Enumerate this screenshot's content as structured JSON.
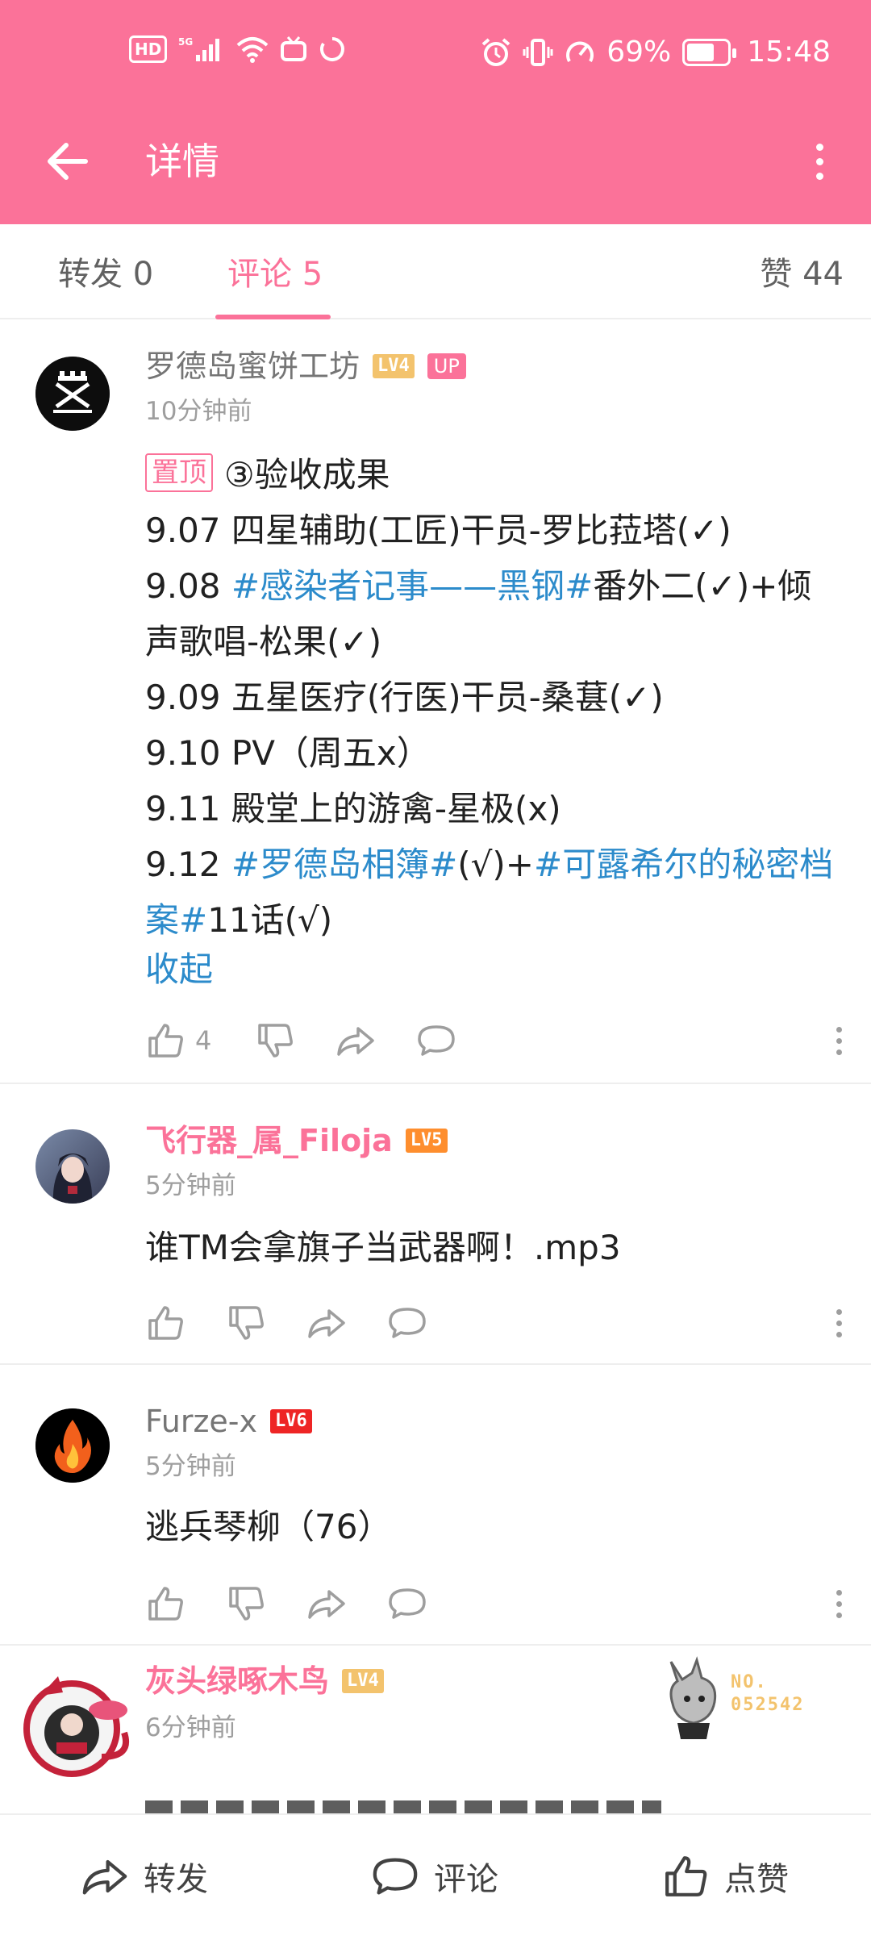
{
  "status_bar": {
    "hd": "HD",
    "network": "5G",
    "battery_percent_text": "69%",
    "battery_level": 0.69,
    "time": "15:48"
  },
  "nav": {
    "title": "详情",
    "back_icon": "arrow-left-icon",
    "more_icon": "more-vertical-icon"
  },
  "tabs": {
    "repost": "转发 0",
    "comments": "评论 5",
    "likes": "赞 44"
  },
  "comments": [
    {
      "user": "罗德岛蜜饼工坊",
      "level": "LV4",
      "up_badge": "UP",
      "time": "10分钟前",
      "pinned": "置顶",
      "lines": [
        {
          "parts": [
            {
              "text": "③验收成果",
              "topic": false
            }
          ]
        },
        {
          "parts": [
            {
              "text": "9.07 四星辅助(工匠)干员-罗比菈塔(✓)",
              "topic": false
            }
          ]
        },
        {
          "parts": [
            {
              "text": "9.08 ",
              "topic": false
            },
            {
              "text": "#感染者记事——黑钢#",
              "topic": true
            },
            {
              "text": "番外二(✓)+倾",
              "topic": false
            }
          ]
        },
        {
          "parts": [
            {
              "text": "声歌唱-松果(✓)",
              "topic": false
            }
          ]
        },
        {
          "parts": [
            {
              "text": "9.09 五星医疗(行医)干员-桑葚(✓)",
              "topic": false
            }
          ]
        },
        {
          "parts": [
            {
              "text": "9.10 PV（周五x）",
              "topic": false
            }
          ]
        },
        {
          "parts": [
            {
              "text": "9.11 殿堂上的游禽-星极(x)",
              "topic": false
            }
          ]
        },
        {
          "parts": [
            {
              "text": "9.12 ",
              "topic": false
            },
            {
              "text": "#罗德岛相簿#",
              "topic": true
            },
            {
              "text": "(√)+",
              "topic": false
            },
            {
              "text": "#可露希尔的秘密档",
              "topic": true
            }
          ]
        },
        {
          "parts": [
            {
              "text": "案#",
              "topic": true
            },
            {
              "text": "11话(√)",
              "topic": false
            }
          ]
        }
      ],
      "collapse": "收起",
      "like_count": "4"
    },
    {
      "user": "飞行器_属_Filoja",
      "level": "LV5",
      "time": "5分钟前",
      "text": "谁TM会拿旗子当武器啊！.mp3"
    },
    {
      "user": "Furze-x",
      "level": "LV6",
      "time": "5分钟前",
      "text": "逃兵琴柳（76）"
    },
    {
      "user": "灰头绿啄木鸟",
      "level": "LV4",
      "time": "6分钟前",
      "fan_no": "NO.\n052542"
    }
  ],
  "bottom_bar": {
    "repost": "转发",
    "comment": "评论",
    "like": "点赞"
  },
  "colors": {
    "brand_pink": "#fb7299",
    "topic_blue": "#2c8bcb",
    "lv4": "#f3c36d",
    "lv5": "#fe8e2e",
    "lv6": "#ee2525"
  }
}
